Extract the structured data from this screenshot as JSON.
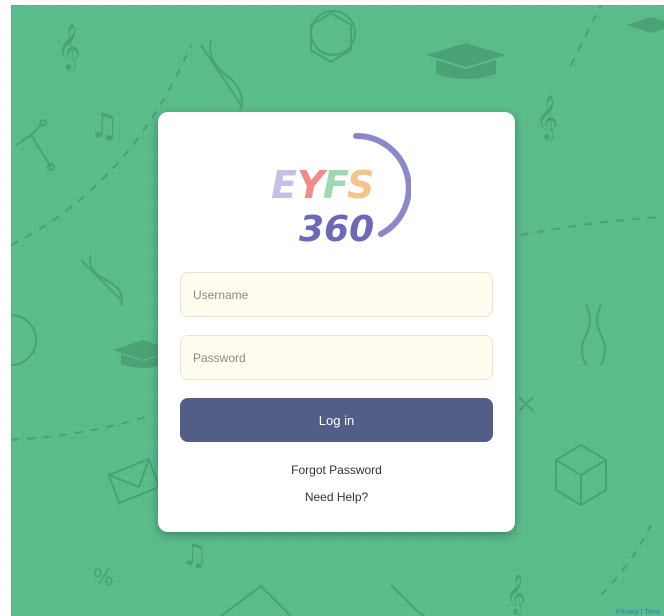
{
  "colors": {
    "background": "#5bbd8c",
    "doodle": "#449a6f",
    "card": "#ffffff",
    "field_bg": "#fffdef",
    "button": "#525e88",
    "logo_arc": "#8b88c9",
    "logo_e": "#c4c1e6",
    "logo_y": "#f28a88",
    "logo_f": "#9fd6b4",
    "logo_s": "#f5c48a",
    "logo_360": "#6d68b8"
  },
  "logo": {
    "top_text": "EYFS",
    "bottom_text": "360",
    "letters": [
      "E",
      "Y",
      "F",
      "S"
    ]
  },
  "login_form": {
    "username_placeholder": "Username",
    "password_placeholder": "Password",
    "login_label": "Log in",
    "forgot_password_label": "Forgot Password",
    "need_help_label": "Need Help?"
  },
  "background_icons": [
    "treble-clef-icon",
    "music-note-icon",
    "graduation-cap-icon",
    "dna-icon",
    "envelope-icon",
    "cube-icon",
    "percent-icon",
    "atom-icon"
  ],
  "footer_fragment": "Privacy | Term"
}
